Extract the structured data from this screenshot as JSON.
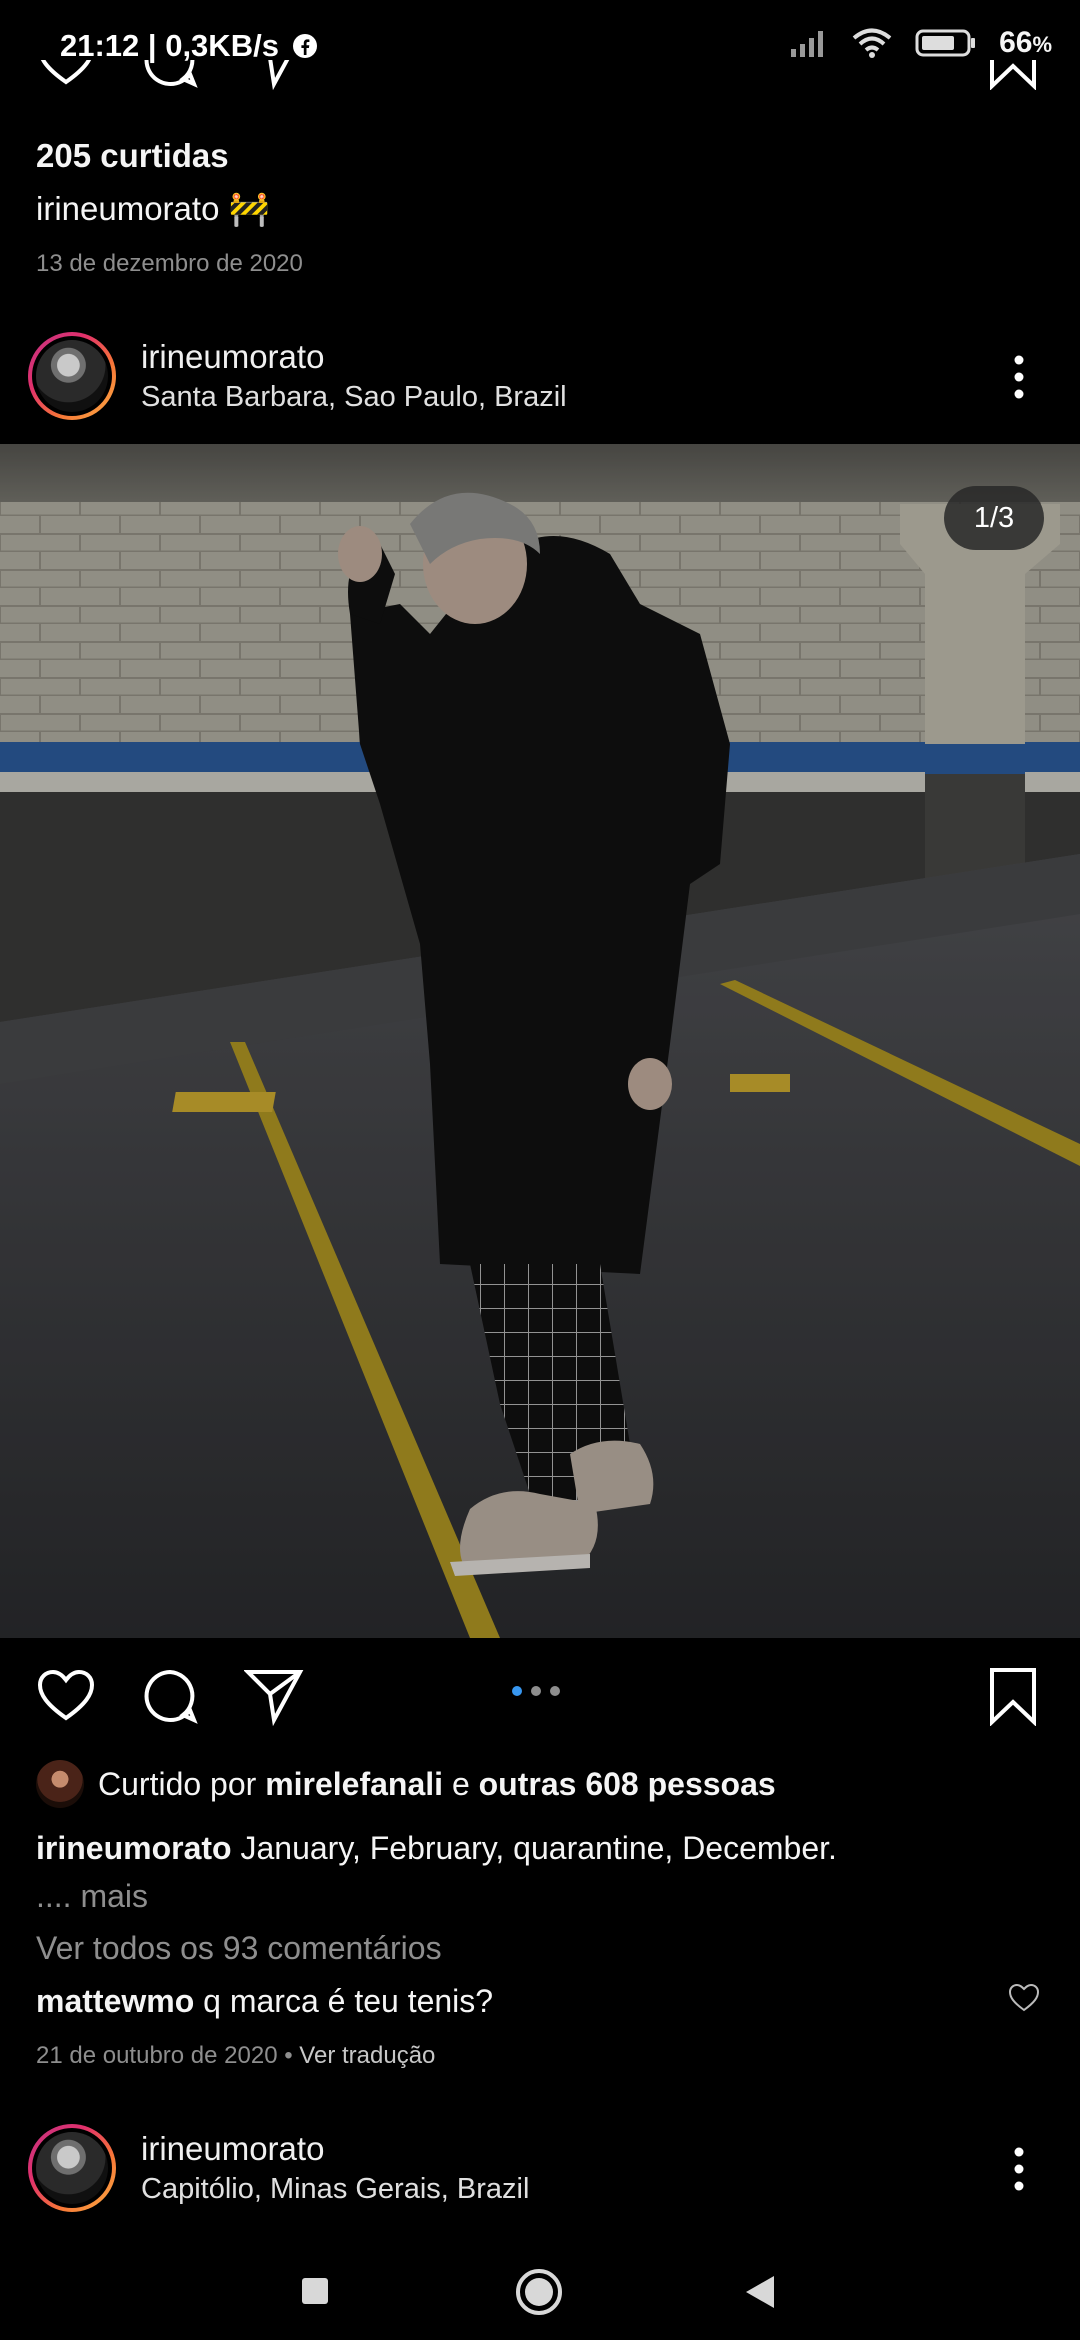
{
  "status": {
    "time": "21:12",
    "net_speed": "| 0,3KB/s",
    "battery": "66",
    "battery_unit": "%",
    "icons": [
      "facebook-icon",
      "signal-icon",
      "wifi-icon",
      "battery-icon"
    ]
  },
  "previous_post": {
    "likes": "205 curtidas",
    "caption": "irineumorato 🚧",
    "date": "13 de dezembro de 2020"
  },
  "post": {
    "username": "irineumorato",
    "location": "Santa Barbara, Sao Paulo, Brazil",
    "image_counter": "1/3",
    "carousel": {
      "total": 3,
      "active": 1
    },
    "liked_by_prefix": "Curtido por",
    "liked_by_user": "mirelefanali",
    "liked_by_joiner": "e",
    "liked_by_others": "outras 608 pessoas",
    "caption_user": "irineumorato",
    "caption_text": "January, February, quarantine, December.",
    "caption_more": ".... mais",
    "view_comments": "Ver todos os 93 comentários",
    "comment_user": "mattewmo",
    "comment_text": "q marca é teu tenis?",
    "comment_date": "21 de outubro de 2020",
    "comment_separator": "•",
    "comment_translate": "Ver tradução"
  },
  "next_post": {
    "username": "irineumorato",
    "location": "Capitólio, Minas Gerais, Brazil"
  },
  "colors": {
    "background": "#000000",
    "accent_blue": "#3897f0",
    "muted_text": "#8e8e8e"
  }
}
